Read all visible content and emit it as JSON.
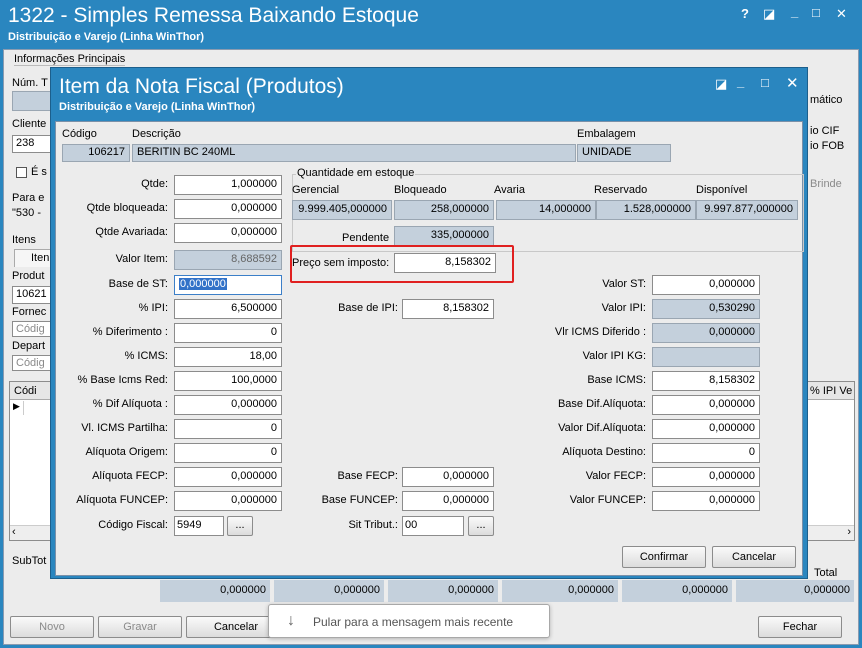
{
  "main": {
    "title": "1322 - Simples Remessa Baixando Estoque",
    "subtitle": "Distribuição e Varejo (Linha WinThor)",
    "controls": {
      "help": "?",
      "restore": "◪",
      "minimize": "_",
      "maximize": "□",
      "close": "✕"
    },
    "group_informacoes": "Informações Principais",
    "lbl_num": "Núm. T",
    "lbl_cliente": "Cliente",
    "cliente_value": "238",
    "chk_label": "É s",
    "lbl_para": "Para e",
    "para_value": "\"530 -",
    "lbl_itens": "Itens",
    "tab_itens": "Iten",
    "lbl_produto": "Produt",
    "produto_value": "10621",
    "lbl_fornec": "Fornec",
    "fornec_placeholder": "Códig",
    "lbl_depart": "Depart",
    "depart_placeholder": "Códig",
    "grid_col_cod": "Códi",
    "grid_col_ipi": "% IPI Ve",
    "right_automatico": "mático",
    "right_cif": "io CIF",
    "right_fob": "io FOB",
    "right_brinde": "Brinde",
    "lbl_subtot": "SubTot",
    "lbl_total": "Total",
    "totals": [
      "0,000000",
      "0,000000",
      "0,000000",
      "0,000000",
      "0,000000",
      "0,000000"
    ],
    "btn_novo": "Novo",
    "btn_gravar": "Gravar",
    "btn_cancelar": "Cancelar",
    "btn_fechar": "Fechar"
  },
  "dialog": {
    "title": "Item da Nota Fiscal (Produtos)",
    "subtitle": "Distribuição e Varejo (Linha WinThor)",
    "controls": {
      "restore": "◪",
      "minimize": "_",
      "maximize": "□",
      "close": "✕"
    },
    "lbl_codigo": "Código",
    "lbl_descricao": "Descrição",
    "lbl_embalagem": "Embalagem",
    "codigo": "106217",
    "descricao": "BERITIN BC 240ML",
    "embalagem": "UNIDADE",
    "qtde_label": "Qtde:",
    "qtde": "1,000000",
    "qtde_bloq_label": "Qtde bloqueada:",
    "qtde_bloq": "0,000000",
    "qtde_avar_label": "Qtde Avariada:",
    "qtde_avar": "0,000000",
    "valor_item_label": "Valor Item:",
    "valor_item": "8,688592",
    "base_st_label": "Base de ST:",
    "base_st": "0,000000",
    "pct_ipi_label": "% IPI:",
    "pct_ipi": "6,500000",
    "pct_dif_label": "% Diferimento :",
    "pct_dif": "0",
    "pct_icms_label": "% ICMS:",
    "pct_icms": "18,00",
    "pct_base_red_label": "% Base Icms Red:",
    "pct_base_red": "100,0000",
    "pct_dif_aliq_label": "% Dif Alíquota :",
    "pct_dif_aliq": "0,000000",
    "vl_icms_part_label": "Vl. ICMS Partilha:",
    "vl_icms_part": "0",
    "aliq_origem_label": "Alíquota Origem:",
    "aliq_origem": "0",
    "aliq_fecp_label": "Alíquota FECP:",
    "aliq_fecp": "0,000000",
    "aliq_funcep_label": "Alíquota FUNCEP:",
    "aliq_funcep": "0,000000",
    "cod_fiscal_label": "Código Fiscal:",
    "cod_fiscal": "5949",
    "ellipsis": "...",
    "qtd_estoque_group": "Quantidade em estoque",
    "col_gerencial": "Gerencial",
    "col_bloqueado": "Bloqueado",
    "col_avaria": "Avaria",
    "col_reservado": "Reservado",
    "col_disponivel": "Disponível",
    "gerencial": "9.999.405,000000",
    "bloqueado": "258,000000",
    "avaria": "14,000000",
    "reservado": "1.528,000000",
    "disponivel": "9.997.877,000000",
    "pendente_label": "Pendente",
    "pendente": "335,000000",
    "preco_sem_imp_label": "Preço sem imposto:",
    "preco_sem_imp": "8,158302",
    "base_ipi_label": "Base de IPI:",
    "base_ipi": "8,158302",
    "base_fecp_label": "Base FECP:",
    "base_fecp": "0,000000",
    "base_funcep_label": "Base FUNCEP:",
    "base_funcep": "0,000000",
    "sit_trib_label": "Sit Tribut.:",
    "sit_trib": "00",
    "valor_st_label": "Valor ST:",
    "valor_st": "0,000000",
    "valor_ipi_label": "Valor IPI:",
    "valor_ipi": "0,530290",
    "vlr_icms_dif_label": "Vlr ICMS Diferido :",
    "vlr_icms_dif": "0,000000",
    "valor_ipi_kg_label": "Valor IPI KG:",
    "valor_ipi_kg": "",
    "base_icms_label": "Base ICMS:",
    "base_icms": "8,158302",
    "base_dif_aliq_label": "Base Dif.Alíquota:",
    "base_dif_aliq": "0,000000",
    "valor_dif_aliq_label": "Valor Dif.Alíquota:",
    "valor_dif_aliq": "0,000000",
    "aliq_destino_label": "Alíquota Destino:",
    "aliq_destino": "0",
    "valor_fecp_label": "Valor FECP:",
    "valor_fecp": "0,000000",
    "valor_funcep_label": "Valor FUNCEP:",
    "valor_funcep": "0,000000",
    "btn_confirmar": "Confirmar",
    "btn_cancelar": "Cancelar"
  },
  "toast": {
    "icon": "arrow-down-icon",
    "text": "Pular para a mensagem mais recente"
  },
  "colors": {
    "title_blue": "#2a86bf",
    "highlight_red": "#e02020",
    "readonly_field": "#c4d0dc"
  }
}
